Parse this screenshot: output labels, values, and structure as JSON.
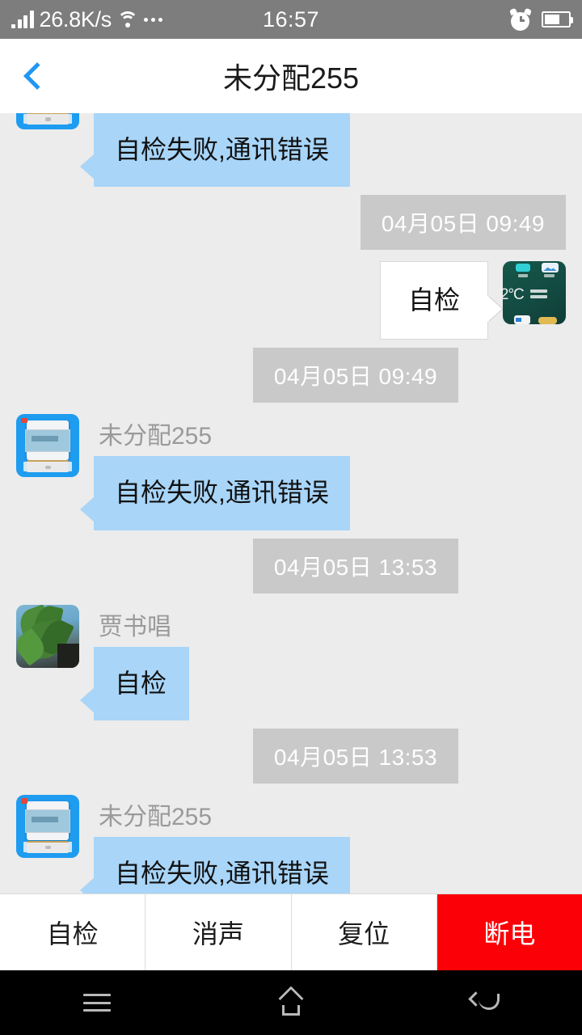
{
  "status_bar": {
    "network_speed": "26.8K/s",
    "time": "16:57",
    "icons": [
      "signal-bars-icon",
      "wifi-icon",
      "more-dots-icon",
      "alarm-clock-icon",
      "battery-icon"
    ],
    "battery_level_pct": 58,
    "background_color": "#7d7d7d"
  },
  "header": {
    "back_label": "",
    "title": "未分配255",
    "back_icon_color": "#2196f3"
  },
  "chat": {
    "background_color": "#ececec",
    "bubble_in_color": "#a8d5f8",
    "bubble_out_color": "#ffffff",
    "timestamp_bg_color": "#c9c9c9",
    "messages": [
      {
        "id": "m1",
        "side": "left",
        "avatar": "meter-device-avatar",
        "sender": "",
        "text": "自检失败,通讯错误",
        "clipped_top": true
      },
      {
        "id": "t1",
        "type": "timestamp",
        "align": "right",
        "text": "04月05日  09:49"
      },
      {
        "id": "m2",
        "side": "right",
        "avatar": "phone-home-screenshot-avatar",
        "sender": "",
        "text": "自检"
      },
      {
        "id": "t2",
        "type": "timestamp",
        "align": "center-right",
        "text": "04月05日  09:49"
      },
      {
        "id": "m3",
        "side": "left",
        "avatar": "meter-device-avatar",
        "sender": "未分配255",
        "text": "自检失败,通讯错误"
      },
      {
        "id": "t3",
        "type": "timestamp",
        "align": "center-right",
        "text": "04月05日  13:53"
      },
      {
        "id": "m4",
        "side": "left",
        "avatar": "plant-photo-avatar",
        "sender": "贾书唱",
        "text": "自检"
      },
      {
        "id": "t4",
        "type": "timestamp",
        "align": "center-right",
        "text": "04月05日  13:53"
      },
      {
        "id": "m5",
        "side": "left",
        "avatar": "meter-device-avatar",
        "sender": "未分配255",
        "text": "自检失败,通讯错误",
        "clipped_bottom": true
      }
    ]
  },
  "action_bar": {
    "buttons": [
      {
        "label": "自检",
        "style": "normal"
      },
      {
        "label": "消声",
        "style": "normal"
      },
      {
        "label": "复位",
        "style": "normal"
      },
      {
        "label": "断电",
        "style": "danger",
        "color": "#fb0007"
      }
    ]
  },
  "nav_bar": {
    "background_color": "#000000",
    "buttons": [
      "menu-icon",
      "home-icon",
      "back-icon"
    ]
  },
  "avatar_screenshot": {
    "temperature_text": "2°C"
  }
}
